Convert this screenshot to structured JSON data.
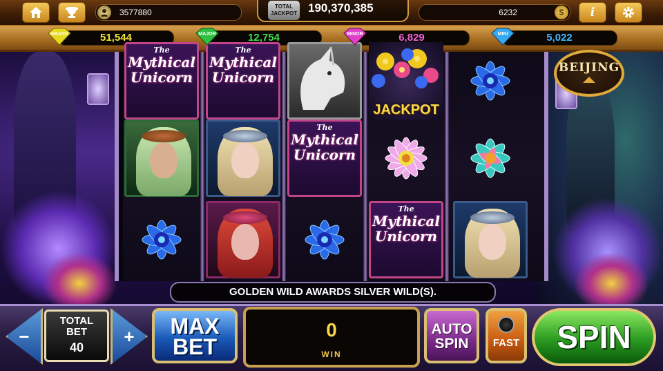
{
  "top_bar": {
    "home_icon": "home-icon",
    "trophy_icon": "trophy-icon",
    "player_id": "3577880",
    "total_jackpot_label": "TOTAL JACKPOT",
    "total_jackpot_amount": "190,370,385",
    "coins": "6232",
    "coin_icon": "$",
    "info_icon": "i",
    "settings_icon": "gear-icon"
  },
  "jackpots": [
    {
      "name": "GRAND",
      "amount": "51,544",
      "color": "#f2e83a"
    },
    {
      "name": "MAJOR",
      "amount": "12,754",
      "color": "#3ee050"
    },
    {
      "name": "MINOR",
      "amount": "6,829",
      "color": "#f060d8"
    },
    {
      "name": "MINI",
      "amount": "5,022",
      "color": "#40b8ff"
    }
  ],
  "reels": {
    "title_symbol": {
      "the": "The",
      "line1": "Mythical",
      "line2": "Unicorn"
    },
    "jackpot_symbol": "JACKPOT"
  },
  "feature_badge": "BEIJING",
  "message": "GOLDEN WILD AWARDS SILVER WILD(S).",
  "controls": {
    "decrease": "−",
    "increase": "+",
    "total_bet_label_1": "TOTAL",
    "total_bet_label_2": "BET",
    "total_bet_value": "40",
    "max_bet_line1": "MAX",
    "max_bet_line2": "BET",
    "win_value": "0",
    "win_label": "WIN",
    "auto_spin_line1": "AUTO",
    "auto_spin_line2": "SPIN",
    "fast_label": "FAST",
    "spin_label": "SPIN"
  }
}
